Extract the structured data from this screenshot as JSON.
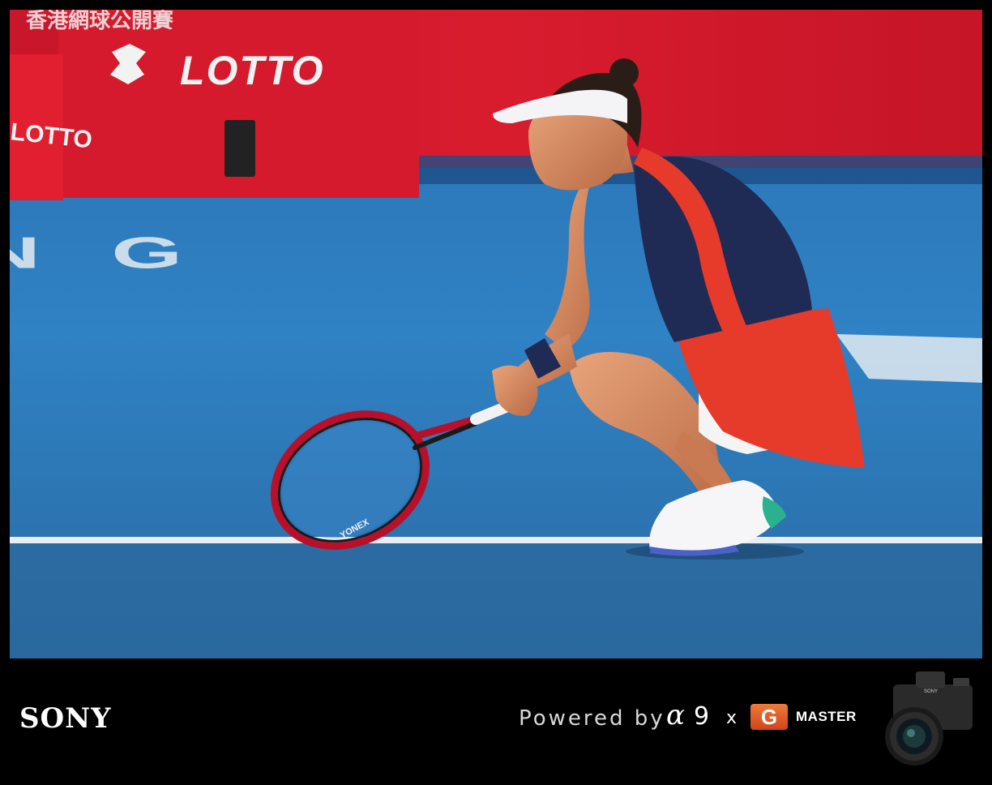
{
  "photo": {
    "banner_text": "LOTTO",
    "banner_side_text": "LOTTO",
    "banner_top_text": "香港網球公開賽",
    "court_text": "NG",
    "racket_brand": "YONEX",
    "colors": {
      "court": "#2e7fc0",
      "wall": "#d81a2c",
      "dress": "#e63b2a",
      "navy": "#1f2a55"
    }
  },
  "footer": {
    "brand": "SONY",
    "powered_by": "Powered by",
    "alpha": "α",
    "model_number": "9",
    "times": "x",
    "g_letter": "G",
    "master": "MASTER",
    "camera_icon": "camera-icon"
  }
}
